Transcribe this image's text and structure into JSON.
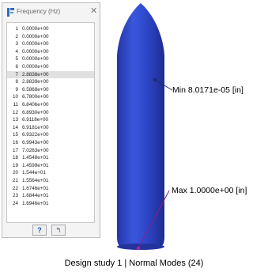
{
  "panel": {
    "title": "Frequency (Hz)",
    "close_icon": "close-icon",
    "selected_mode": 7,
    "modes": [
      {
        "n": "1",
        "f": "0.0000e+00"
      },
      {
        "n": "2",
        "f": "0.0000e+00"
      },
      {
        "n": "3",
        "f": "0.0000e+00"
      },
      {
        "n": "4",
        "f": "0.0000e+00"
      },
      {
        "n": "5",
        "f": "0.0000e+00"
      },
      {
        "n": "6",
        "f": "0.0000e+00"
      },
      {
        "n": "7",
        "f": "2.8838e+00"
      },
      {
        "n": "8",
        "f": "2.8839e+00"
      },
      {
        "n": "9",
        "f": "6.5868e+00"
      },
      {
        "n": "10",
        "f": "6.7800e+00"
      },
      {
        "n": "11",
        "f": "6.8406e+00"
      },
      {
        "n": "12",
        "f": "6.8930e+00"
      },
      {
        "n": "13",
        "f": "6.9118e+00"
      },
      {
        "n": "14",
        "f": "6.9181e+00"
      },
      {
        "n": "15",
        "f": "6.9322e+00"
      },
      {
        "n": "16",
        "f": "6.9943e+00"
      },
      {
        "n": "17",
        "f": "7.0263e+00"
      },
      {
        "n": "18",
        "f": "1.4548e+01"
      },
      {
        "n": "19",
        "f": "1.4599e+01"
      },
      {
        "n": "20",
        "f": "1.544e+01"
      },
      {
        "n": "21",
        "f": "1.5564e+01"
      },
      {
        "n": "22",
        "f": "1.6746e+01"
      },
      {
        "n": "23",
        "f": "1.6844e+01"
      },
      {
        "n": "24",
        "f": "1.6946e+01"
      }
    ],
    "help_label": "?",
    "back_label": "↰"
  },
  "annotations": {
    "min_label": "Min  8.0171e-05  [in]",
    "max_label": "Max  1.0000e+00  [in]"
  },
  "caption": "Design study 1 | Normal Modes (24)",
  "colors": {
    "model_body": "#2e45c8",
    "leader_min": "#1f2a66",
    "leader_max": "#8b1f7a"
  }
}
